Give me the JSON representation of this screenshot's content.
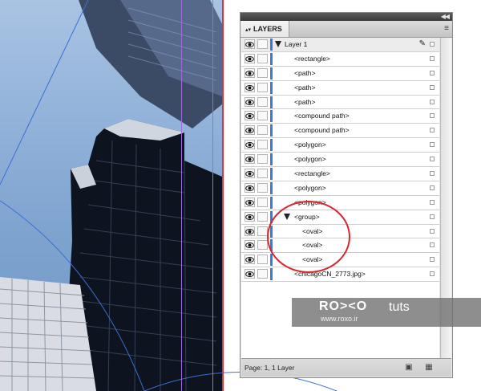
{
  "panel": {
    "tab_label": "LAYERS",
    "tab_arrows": "▴▾",
    "menu_icon": "≡",
    "collapse_icon": "◀◀",
    "footer_status": "Page: 1, 1 Layer",
    "new_layer_icon": "new-layer-icon",
    "trash_icon": "trash-icon"
  },
  "layers": [
    {
      "label": "Layer 1",
      "type": "layer",
      "expanded": true
    },
    {
      "label": "<rectangle>",
      "type": "item"
    },
    {
      "label": "<path>",
      "type": "item"
    },
    {
      "label": "<path>",
      "type": "item"
    },
    {
      "label": "<path>",
      "type": "item"
    },
    {
      "label": "<compound path>",
      "type": "item"
    },
    {
      "label": "<compound path>",
      "type": "item"
    },
    {
      "label": "<polygon>",
      "type": "item"
    },
    {
      "label": "<polygon>",
      "type": "item"
    },
    {
      "label": "<rectangle>",
      "type": "item"
    },
    {
      "label": "<polygon>",
      "type": "item"
    },
    {
      "label": "<polygon>",
      "type": "item"
    },
    {
      "label": "<group>",
      "type": "group",
      "expanded": true
    },
    {
      "label": "<oval>",
      "type": "child"
    },
    {
      "label": "<oval>",
      "type": "child"
    },
    {
      "label": "<oval>",
      "type": "child"
    },
    {
      "label": "<chicagoCN_2773.jpg>",
      "type": "item"
    }
  ],
  "watermark": {
    "brand": "RO><O",
    "tuts": "tuts",
    "url": "www.roxo.ir"
  },
  "colors": {
    "layer_color": "#3f79d6",
    "annotation": "#d8262e",
    "guide_red": "#e0313a",
    "guide_purple": "#9b6bd6"
  }
}
